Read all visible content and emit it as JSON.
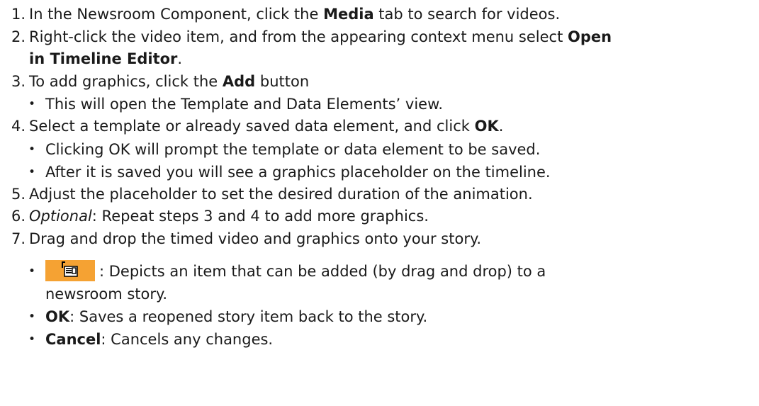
{
  "steps": [
    {
      "n": "1.",
      "pre": "In the Newsroom Component, click the ",
      "b1": "Media",
      "post": " tab to search for videos."
    },
    {
      "n": "2.",
      "pre": "Right-click the video item, and from the appearing context menu select ",
      "b1": "Open",
      "b2": "in Timeline Editor",
      "post": "."
    },
    {
      "n": "3.",
      "pre": "To add graphics, click the ",
      "b1": "Add",
      "post": " button",
      "sub": [
        "This will open the Template and Data Elements’ view."
      ]
    },
    {
      "n": "4.",
      "pre": "Select a template or already saved data element, and click ",
      "b1": "OK",
      "post": ".",
      "sub": [
        "Clicking OK will prompt the template or data element to be saved.",
        "After it is saved you will see a graphics placeholder on the timeline."
      ]
    },
    {
      "n": "5.",
      "text": "Adjust the placeholder to set the desired duration of the animation."
    },
    {
      "n": "6.",
      "em": "Optional",
      "post": ": Repeat steps 3 and 4 to add more graphics."
    },
    {
      "n": "7.",
      "text": "Drag and drop the timed video and graphics onto your story."
    }
  ],
  "bullet_char": "•",
  "legend": {
    "icon_name": "drag-to-story-icon",
    "icon_color": "#f5a233",
    "icon_desc_1": ": Depicts an item that can be added (by drag and drop) to a",
    "icon_desc_2": "newsroom story.",
    "ok_label": "OK",
    "ok_desc": ": Saves a reopened story item back to the story.",
    "cancel_label": "Cancel",
    "cancel_desc": ": Cancels any changes."
  }
}
